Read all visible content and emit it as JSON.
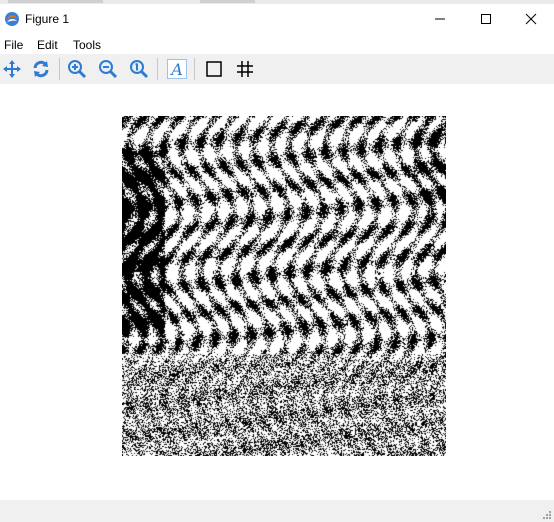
{
  "window": {
    "title": "Figure 1"
  },
  "menu": {
    "items": [
      "File",
      "Edit",
      "Tools"
    ]
  },
  "toolbar": {
    "buttons": [
      "pan-icon",
      "reset-view-icon",
      "zoom-in-icon",
      "zoom-out-icon",
      "zoom-actual-icon",
      "text-icon",
      "rectangle-icon",
      "grid-icon"
    ]
  },
  "figure": {
    "image": "binary black and white texture image"
  },
  "colors": {
    "toolbar_bg": "#f0f0f0",
    "icon_blue": "#2e7bd1",
    "image_fg": "#000000",
    "image_bg": "#ffffff"
  }
}
